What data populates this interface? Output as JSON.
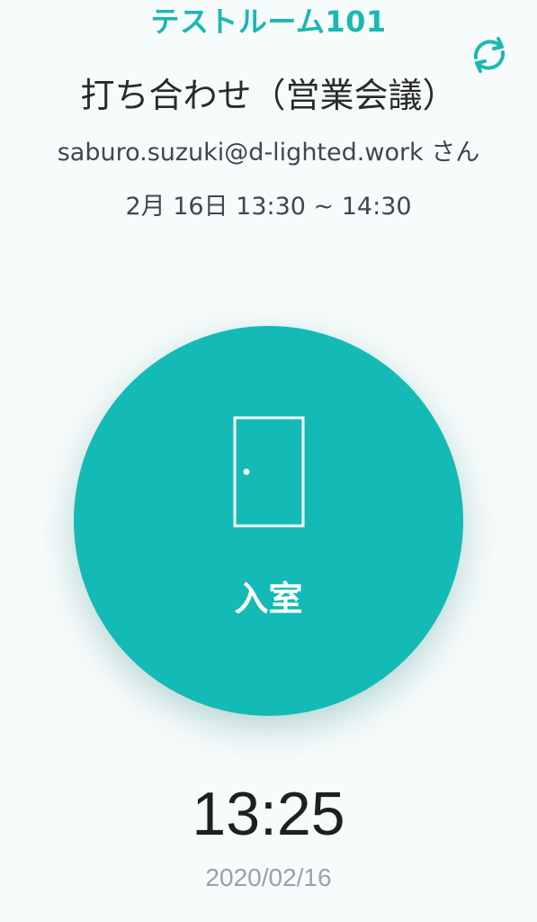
{
  "header": {
    "room_name": "テストルーム101",
    "refresh_icon": "refresh-icon"
  },
  "meeting": {
    "title": "打ち合わせ（営業会議）",
    "user": "saburo.suzuki@d-lighted.work さん",
    "schedule": "2月 16日 13:30 ~ 14:30"
  },
  "action": {
    "enter_label": "入室",
    "icon": "door-icon"
  },
  "clock": {
    "time": "13:25",
    "date": "2020/02/16"
  },
  "colors": {
    "accent": "#14bab5",
    "background": "#f6fbfb",
    "text": "#2a2a2a",
    "muted": "#9aa0ae"
  }
}
